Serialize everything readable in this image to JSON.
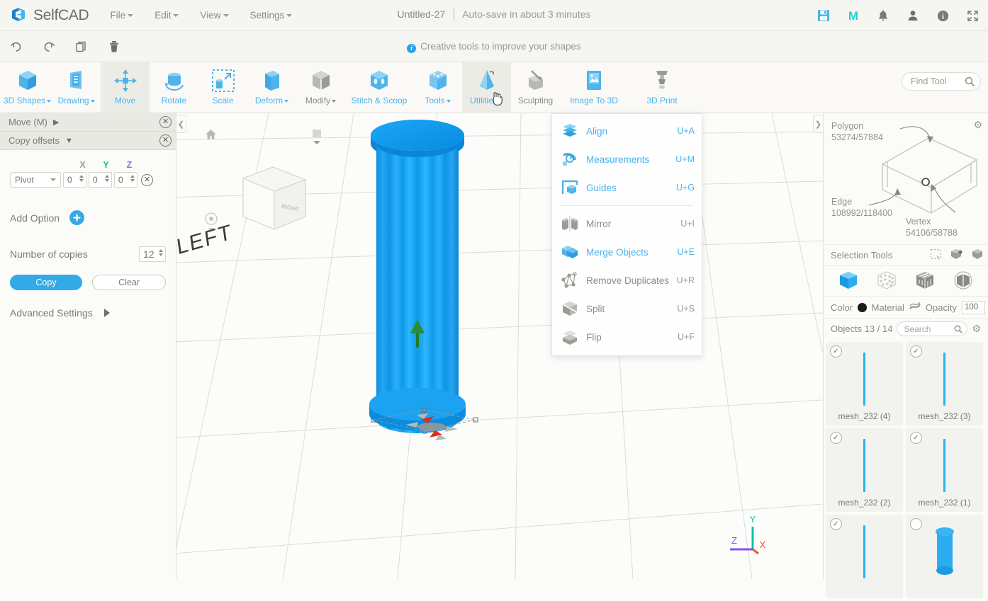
{
  "app": {
    "brand": "SelfCAD",
    "menus": [
      "File",
      "Edit",
      "View",
      "Settings"
    ],
    "document_title": "Untitled-27",
    "autosave_text": "Auto-save in about 3 minutes",
    "top_icons": [
      "save-icon",
      "magic-m-icon",
      "notification-bell-icon",
      "user-account-icon",
      "info-icon",
      "fullscreen-icon"
    ]
  },
  "editbar": {
    "icons": [
      "undo-icon",
      "redo-icon",
      "copy-icon",
      "delete-icon"
    ],
    "hint": "Creative tools to improve your shapes"
  },
  "ribbon": {
    "items": [
      {
        "label": "3D Shapes",
        "caret": true,
        "style": "blue"
      },
      {
        "label": "Drawing",
        "caret": true,
        "style": "blue"
      },
      {
        "label": "Move",
        "caret": false,
        "style": "blue"
      },
      {
        "label": "Rotate",
        "caret": false,
        "style": "blue"
      },
      {
        "label": "Scale",
        "caret": false,
        "style": "blue"
      },
      {
        "label": "Deform",
        "caret": true,
        "style": "blue"
      },
      {
        "label": "Modify",
        "caret": true,
        "style": "grey"
      },
      {
        "label": "Stitch & Scoop",
        "caret": false,
        "style": "blue"
      },
      {
        "label": "Tools",
        "caret": true,
        "style": "blue"
      },
      {
        "label": "Utilities",
        "caret": true,
        "style": "blue"
      },
      {
        "label": "Sculpting",
        "caret": false,
        "style": "grey"
      },
      {
        "label": "Image To 3D",
        "caret": false,
        "style": "blue"
      },
      {
        "label": "3D Print",
        "caret": false,
        "style": "blue"
      }
    ],
    "find_tool_placeholder": "Find Tool"
  },
  "left_panel": {
    "tool_title": "Move (M)",
    "section_title": "Copy offsets",
    "axes": [
      "X",
      "Y",
      "Z"
    ],
    "pivot_label": "Pivot",
    "offset_x": "0",
    "offset_y": "0",
    "offset_z": "0",
    "add_option_label": "Add Option",
    "copies_label": "Number of copies",
    "copies_value": "12",
    "copy_button": "Copy",
    "clear_button": "Clear",
    "advanced_label": "Advanced Settings"
  },
  "viewport": {
    "viewcube_face": "RIGHT",
    "viewcube_left_text": "LEFT",
    "axis_labels": {
      "x": "X",
      "y": "Y",
      "z": "Z"
    },
    "axis_colors": {
      "x": "#f2542d",
      "y": "#0fbf9f",
      "z": "#8b4ff0"
    },
    "object_color": "#00a2f5"
  },
  "dropdown": {
    "items": [
      {
        "label": "Align",
        "key": "U+A",
        "style": "blue",
        "icon": "align-icon"
      },
      {
        "label": "Measurements",
        "key": "U+M",
        "style": "blue",
        "icon": "measurements-icon"
      },
      {
        "label": "Guides",
        "key": "U+G",
        "style": "blue",
        "icon": "guides-icon"
      },
      {
        "label": "Mirror",
        "key": "U+I",
        "style": "grey",
        "icon": "mirror-icon"
      },
      {
        "label": "Merge Objects",
        "key": "U+E",
        "style": "blue",
        "icon": "merge-objects-icon"
      },
      {
        "label": "Remove Duplicates",
        "key": "U+R",
        "style": "grey",
        "icon": "remove-duplicates-icon"
      },
      {
        "label": "Split",
        "key": "U+S",
        "style": "grey",
        "icon": "split-icon"
      },
      {
        "label": "Flip",
        "key": "U+F",
        "style": "grey",
        "icon": "flip-icon"
      }
    ],
    "separator_after_index": 2
  },
  "right_panel": {
    "polygon_label": "Polygon",
    "polygon_value": "53274/57884",
    "edge_label": "Edge",
    "edge_value": "108992/118400",
    "vertex_label": "Vertex",
    "vertex_value": "54106/58788",
    "selection_tools_label": "Selection Tools",
    "color_label": "Color",
    "material_label": "Material",
    "opacity_label": "Opacity",
    "opacity_value": "100",
    "objects_label": "Objects 13 / 14",
    "search_placeholder": "Search",
    "objects": [
      {
        "name": "mesh_232 (4)",
        "checked": true,
        "thumb": "bar"
      },
      {
        "name": "mesh_232 (3)",
        "checked": true,
        "thumb": "bar"
      },
      {
        "name": "mesh_232 (2)",
        "checked": true,
        "thumb": "bar"
      },
      {
        "name": "mesh_232 (1)",
        "checked": true,
        "thumb": "bar"
      },
      {
        "name": "",
        "checked": true,
        "thumb": "bar"
      },
      {
        "name": "",
        "checked": false,
        "thumb": "cylinder"
      }
    ]
  }
}
